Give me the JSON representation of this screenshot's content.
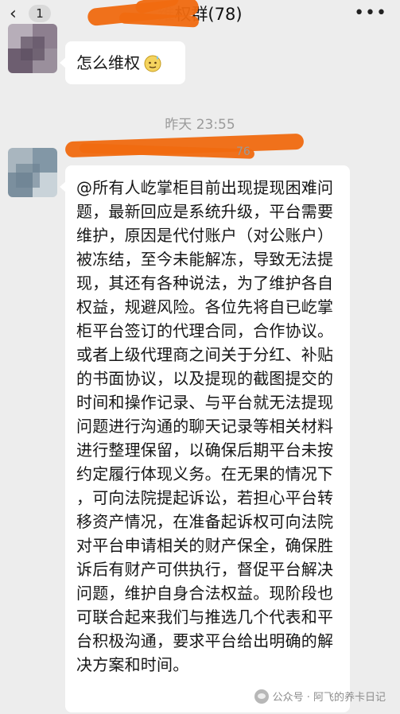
{
  "header": {
    "back_badge": "1",
    "title_visible": "权群(78)",
    "title_fade": "维"
  },
  "messages": [
    {
      "text": "怎么维权",
      "emoji": "emoji-sweat-face"
    },
    {
      "text": "@所有人屹掌柜目前出现提现困难问题，最新回应是系统升级，平台需要维护，原因是代付账户（对公账户）被冻结，至今未能解冻，导致无法提现，其还有各种说法，为了维护各自权益，规避风险。各位先将自已屹掌柜平台签订的代理合同，合作协议。或者上级代理商之间关于分红、补贴的书面协议，以及提现的截图提交的时间和操作记录、与平台就无法提现问题进行沟通的聊天记录等相关材料进行整理保留，以确保后期平台未按约定履行体现义务。在无果的情况下，可向法院提起诉讼，若担心平台转移资产情况，在准备起诉权可向法院对平台申请相关的财产保全，确保胜诉后有财产可供执行，督促平台解决问题，维护自身合法权益。现阶段也可联合起来我们与推选几个代表和平台积极沟通，要求平台给出明确的解决方案和时间。"
    }
  ],
  "timestamp": "昨天 23:55",
  "sender_partial": "76",
  "watermark": "公众号 · 阿飞的养卡日记"
}
